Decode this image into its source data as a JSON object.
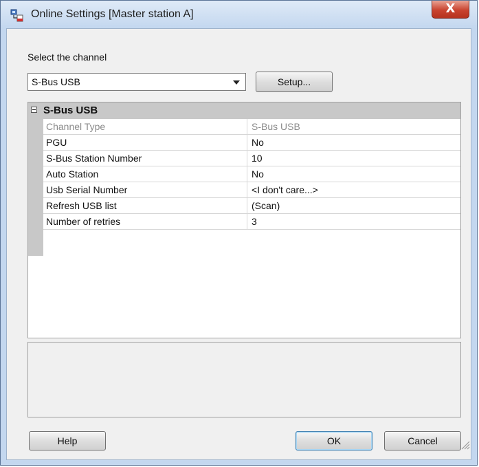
{
  "window": {
    "title": "Online Settings [Master station A]",
    "icon": "online-settings-icon",
    "close_icon": "close-icon",
    "close_glyph": "X"
  },
  "channel": {
    "label": "Select the channel",
    "selected": "S-Bus USB",
    "setup_label": "Setup..."
  },
  "grid": {
    "category": "S-Bus USB",
    "properties": [
      {
        "name": "Channel Type",
        "value": "S-Bus USB",
        "disabled": true
      },
      {
        "name": "PGU",
        "value": "No"
      },
      {
        "name": "S-Bus Station Number",
        "value": "10"
      },
      {
        "name": "Auto Station",
        "value": "No"
      },
      {
        "name": "Usb Serial Number",
        "value": "<I don't care...>"
      },
      {
        "name": "Refresh USB list",
        "value": "(Scan)"
      },
      {
        "name": "Number of retries",
        "value": "3"
      }
    ]
  },
  "buttons": {
    "help": "Help",
    "ok": "OK",
    "cancel": "Cancel"
  },
  "colors": {
    "frame": "#c3d7ef",
    "close": "#c9432f",
    "category": "#c8c8c8"
  }
}
